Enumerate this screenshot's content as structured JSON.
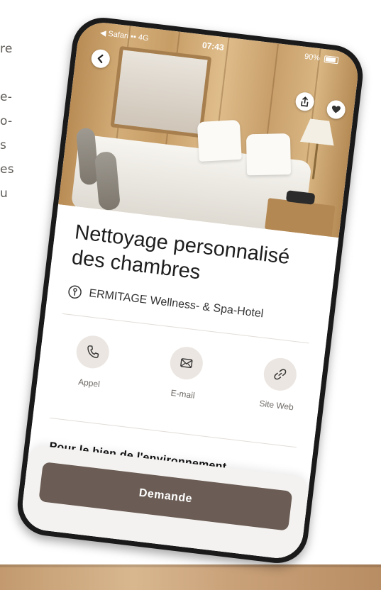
{
  "background_text": {
    "lines": [
      "re",
      "",
      "e-",
      "o-",
      "s",
      "es",
      "u"
    ]
  },
  "status_bar": {
    "carrier": "◀ Safari ▪▪ 4G",
    "time": "07:43",
    "battery": "90%"
  },
  "header": {
    "back_icon": "chevron-left-icon",
    "share_icon": "share-icon",
    "favorite_icon": "heart-icon"
  },
  "offer": {
    "title_line1": "Nettoyage personnalisé",
    "title_line2": "des chambres",
    "location_icon": "info-pin-icon",
    "location": "ERMITAGE Wellness- & Spa-Hotel"
  },
  "actions": [
    {
      "label": "Appel",
      "icon": "phone-icon"
    },
    {
      "label": "E-mail",
      "icon": "envelope-icon"
    },
    {
      "label": "Site Web",
      "icon": "link-icon"
    }
  ],
  "section": {
    "title": "Pour le bien de l'environnement"
  },
  "cta": {
    "label": "Demande"
  },
  "colors": {
    "accent": "#6b5d55",
    "action_bg": "#ebe6e1",
    "sheet_bg": "#f4f2f0"
  }
}
